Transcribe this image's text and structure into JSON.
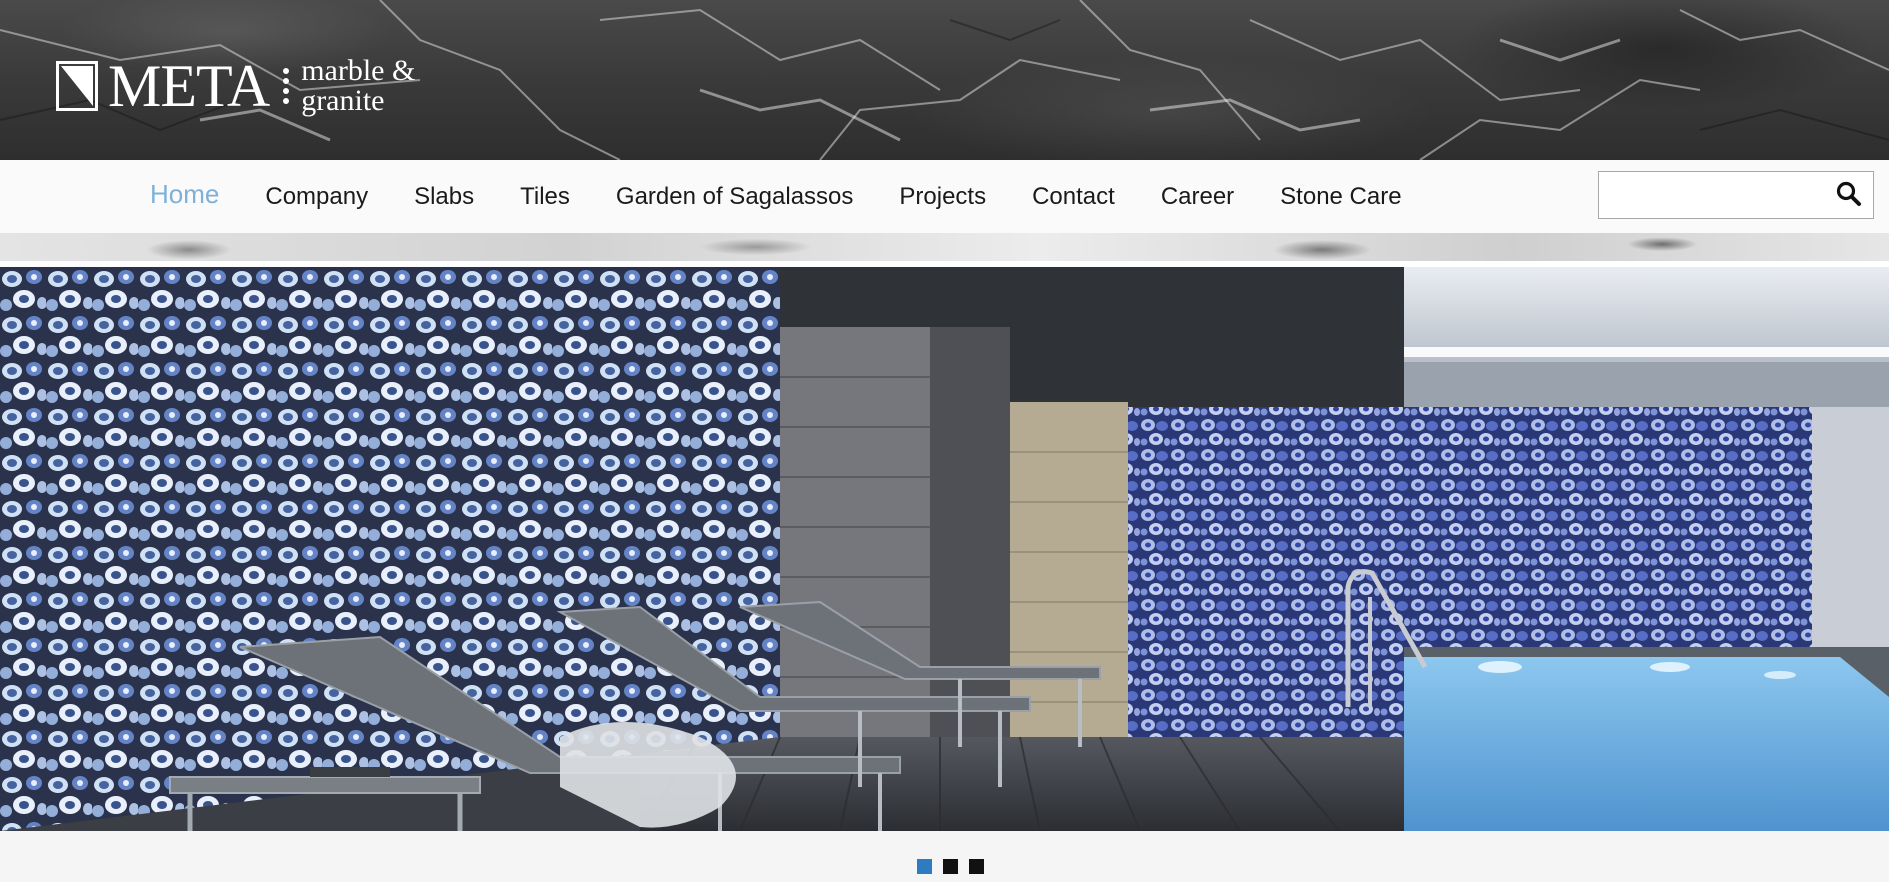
{
  "brand": {
    "name": "META",
    "tagline_line1": "marble &",
    "tagline_line2": "granite"
  },
  "nav": {
    "items": [
      {
        "label": "Home",
        "active": true
      },
      {
        "label": "Company"
      },
      {
        "label": "Slabs"
      },
      {
        "label": "Tiles"
      },
      {
        "label": "Garden of Sagalassos"
      },
      {
        "label": "Projects"
      },
      {
        "label": "Contact"
      },
      {
        "label": "Career"
      },
      {
        "label": "Stone Care"
      }
    ],
    "active_color": "#7fb1d8"
  },
  "search": {
    "value": "",
    "icon": "search-icon"
  },
  "hero": {
    "image": "indoor pool with blue agate stone walls and lounge chairs"
  },
  "slider": {
    "slide_count": 3,
    "active_index": 0,
    "active_color": "#2f7bc1"
  }
}
